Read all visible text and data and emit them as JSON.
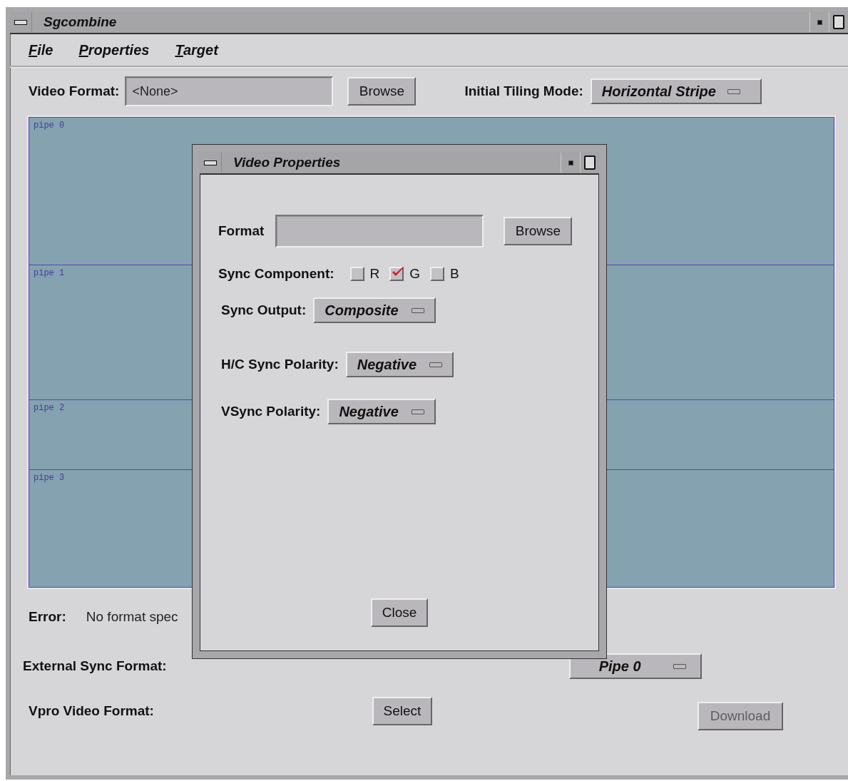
{
  "window": {
    "title": "Sgcombine"
  },
  "menu": [
    {
      "label": "File"
    },
    {
      "label": "Properties"
    },
    {
      "label": "Target"
    }
  ],
  "video_format": {
    "label": "Video Format:",
    "value": "<None>",
    "browse": "Browse"
  },
  "tiling": {
    "label": "Initial Tiling Mode:",
    "value": "Horizontal Stripe"
  },
  "pipes": [
    {
      "label": "pipe 0"
    },
    {
      "label": "pipe 1"
    },
    {
      "label": "pipe 2"
    },
    {
      "label": "pipe 3"
    }
  ],
  "error": {
    "label": "Error:",
    "message": "No format spec"
  },
  "external_sync": {
    "label": "External Sync Format:",
    "sync_source": "Pipe 0"
  },
  "vpro": {
    "label": "Vpro Video Format:",
    "select": "Select"
  },
  "download": {
    "label": "Download",
    "disabled": true
  },
  "dialog": {
    "title": "Video Properties",
    "format_label": "Format",
    "browse": "Browse",
    "sync_component_label": "Sync Component:",
    "components": [
      {
        "label": "R",
        "checked": false
      },
      {
        "label": "G",
        "checked": true
      },
      {
        "label": "B",
        "checked": false
      }
    ],
    "options": [
      {
        "label": "Sync Output:",
        "value": "Composite"
      },
      {
        "label": "H/C Sync Polarity:",
        "value": "Negative"
      },
      {
        "label": "VSync Polarity:",
        "value": "Negative"
      }
    ],
    "close": "Close"
  }
}
